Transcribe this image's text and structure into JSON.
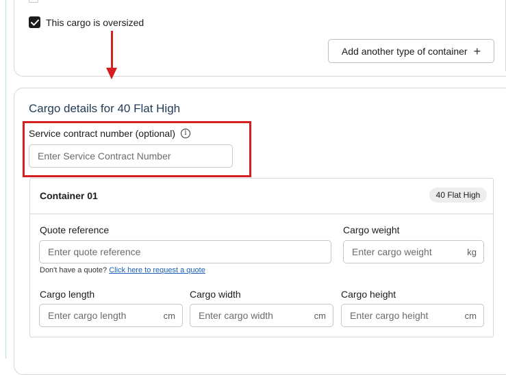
{
  "cargo_options": {
    "oversized_label": "This cargo is oversized",
    "oversized_checked": true
  },
  "add_container_label": "Add another type of container",
  "cargo_details": {
    "title": "Cargo details for 40 Flat High",
    "service_contract": {
      "label": "Service contract number (optional)",
      "info_glyph": "i",
      "placeholder": "Enter Service Contract Number"
    }
  },
  "container": {
    "title": "Container 01",
    "badge": "40 Flat High",
    "quote_reference": {
      "label": "Quote reference",
      "placeholder": "Enter quote reference"
    },
    "no_quote_text": "Don't have a quote?",
    "request_quote_link": "Click here to request a quote",
    "cargo_weight": {
      "label": "Cargo weight",
      "placeholder": "Enter cargo weight",
      "unit": "kg"
    },
    "cargo_length": {
      "label": "Cargo length",
      "placeholder": "Enter cargo length",
      "unit": "cm"
    },
    "cargo_width": {
      "label": "Cargo width",
      "placeholder": "Enter cargo width",
      "unit": "cm"
    },
    "cargo_height": {
      "label": "Cargo height",
      "placeholder": "Enter cargo height",
      "unit": "cm"
    }
  },
  "colors": {
    "annotation_red": "#d71e1e",
    "link_blue": "#1a5fb4",
    "title_navy": "#1f3a55",
    "checkbox_fill": "#1d1d1d"
  }
}
